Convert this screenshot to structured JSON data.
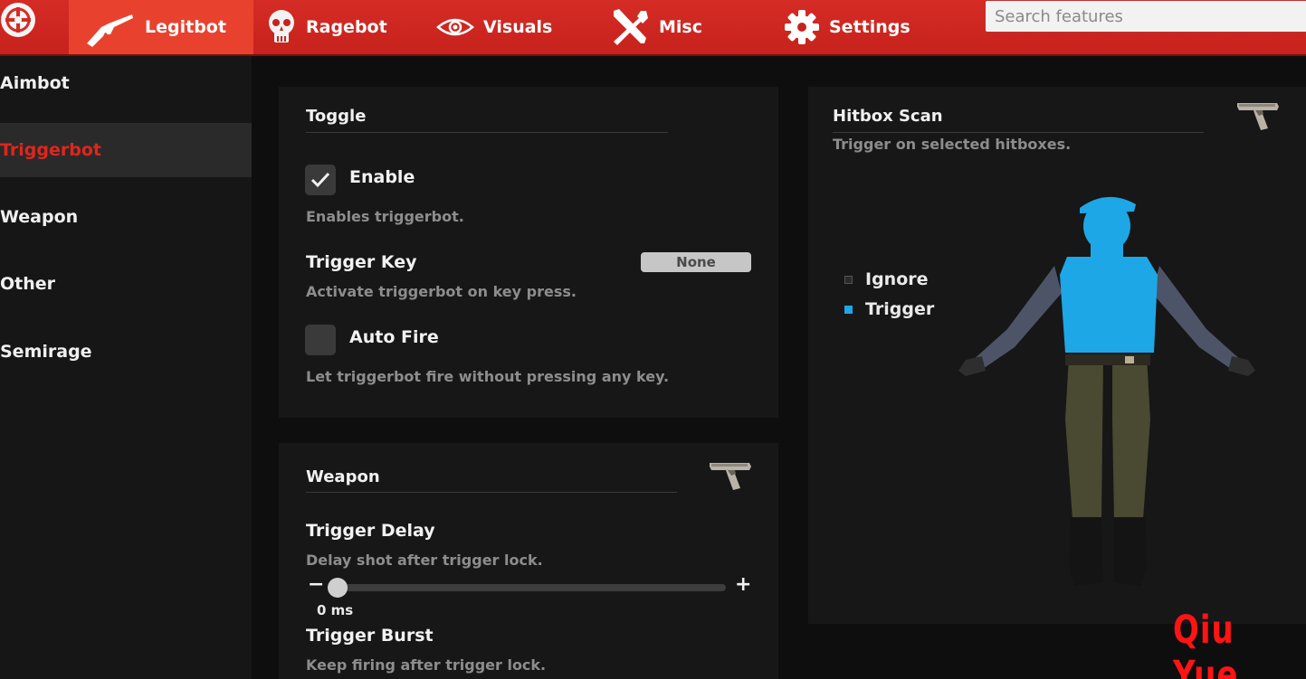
{
  "nav": {
    "tabs": [
      {
        "label": "Legitbot",
        "icon": "rifle-icon",
        "active": true
      },
      {
        "label": "Ragebot",
        "icon": "skull-icon",
        "active": false
      },
      {
        "label": "Visuals",
        "icon": "eye-icon",
        "active": false
      },
      {
        "label": "Misc",
        "icon": "tools-icon",
        "active": false
      },
      {
        "label": "Settings",
        "icon": "gear-icon",
        "active": false
      }
    ],
    "search_placeholder": "Search features"
  },
  "sidebar": {
    "items": [
      {
        "label": "Aimbot",
        "active": false
      },
      {
        "label": "Triggerbot",
        "active": true
      },
      {
        "label": "Weapon",
        "active": false
      },
      {
        "label": "Other",
        "active": false
      },
      {
        "label": "Semirage",
        "active": false
      }
    ]
  },
  "toggle_panel": {
    "title": "Toggle",
    "enable": {
      "label": "Enable",
      "checked": true,
      "description": "Enables triggerbot."
    },
    "trigger_key": {
      "label": "Trigger Key",
      "value": "None",
      "description": "Activate triggerbot on key press."
    },
    "auto_fire": {
      "label": "Auto Fire",
      "checked": false,
      "description": "Let triggerbot fire without pressing any key."
    }
  },
  "weapon_panel": {
    "title": "Weapon",
    "trigger_delay": {
      "label": "Trigger Delay",
      "description": "Delay shot after trigger lock.",
      "value_text": "0 ms",
      "value": 0,
      "minus": "−",
      "plus": "+"
    },
    "trigger_burst": {
      "label": "Trigger Burst",
      "description": "Keep firing after trigger lock."
    }
  },
  "hitbox_panel": {
    "title": "Hitbox Scan",
    "description": "Trigger on selected hitboxes.",
    "legend": [
      {
        "label": "Ignore",
        "color": "#2a2a2a"
      },
      {
        "label": "Trigger",
        "color": "#1ea7e6"
      }
    ]
  },
  "colors": {
    "accent_red": "#d52b25",
    "trigger_blue": "#1ea7e6",
    "active_sidebar_text": "#e1251b"
  },
  "watermark": "Qiu Yue"
}
